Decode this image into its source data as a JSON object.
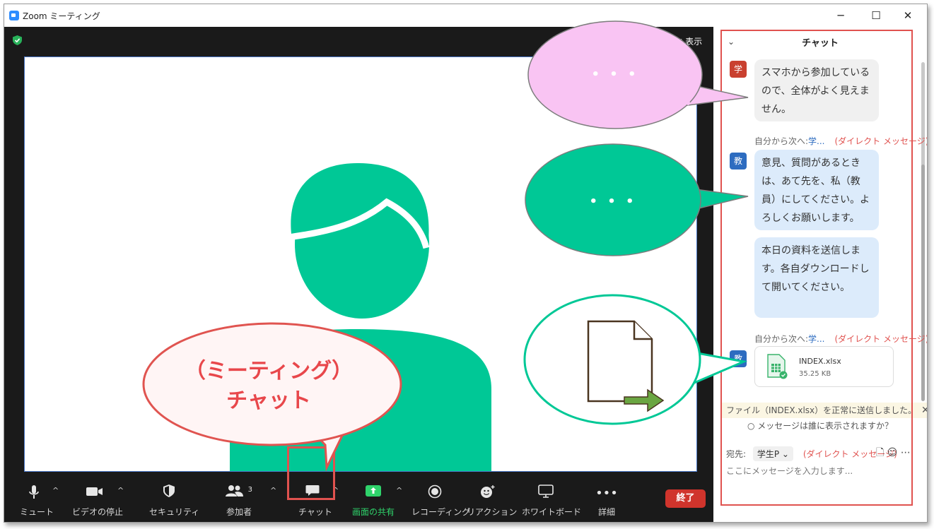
{
  "window": {
    "title": "Zoom ミーティング",
    "controls": {
      "minimize": "─",
      "maximize": "☐",
      "close": "✕"
    }
  },
  "video": {
    "view_label": "▦ 表示"
  },
  "toolbar": {
    "mute_label": "ミュート",
    "video_label": "ビデオの停止",
    "security_label": "セキュリティ",
    "participants_label": "参加者",
    "participants_count": "3",
    "chat_label": "チャット",
    "share_label": "画面の共有",
    "record_label": "レコーディング",
    "reaction_label": "リアクション",
    "whiteboard_label": "ホワイトボード",
    "more_label": "詳細",
    "end_label": "終了",
    "colors": {
      "share": "#2fd36b",
      "end": "#d0342c"
    }
  },
  "chat": {
    "title": "チャット",
    "messages": [
      {
        "avatar": "学",
        "avatar_color": "#c9402f",
        "text": "スマホから参加しているので、全体がよく見えません。"
      },
      {
        "meta_from": "自分から次へ:",
        "meta_to": "学...",
        "meta_dm": "(ダイレクト メッセージ)"
      },
      {
        "avatar": "教",
        "avatar_color": "#2d6cc0",
        "text": "意見、質問があるときは、あて先を、私（教員）にしてください。よろしくお願いします。"
      },
      {
        "text": "本日の資料を送信します。各自ダウンロードして開いてください。"
      },
      {
        "meta_from": "自分から次へ:",
        "meta_to": "学...",
        "meta_dm": "(ダイレクト メッセージ)"
      },
      {
        "avatar": "教",
        "avatar_color": "#2d6cc0",
        "file_name": "INDEX.xlsx",
        "file_size": "35.25 KB"
      }
    ],
    "notice": "ファイル（INDEX.xlsx）を正常に送信しました。",
    "who_sees": "メッセージは誰に表示されますか？",
    "recipient_label": "宛先:",
    "recipient_value": "学生P ⌄",
    "recipient_dm": "(ダイレクト メッセージ)",
    "input_placeholder": "ここにメッセージを入力します..."
  },
  "callouts": {
    "pink_dots": "• • •",
    "green_dots": "• • •",
    "main_line1": "（ミーティング）",
    "main_line2": "チャット"
  },
  "colors": {
    "accent_green": "#00c896",
    "highlight_red": "#e0524f",
    "pink": "#f9c4f3"
  }
}
